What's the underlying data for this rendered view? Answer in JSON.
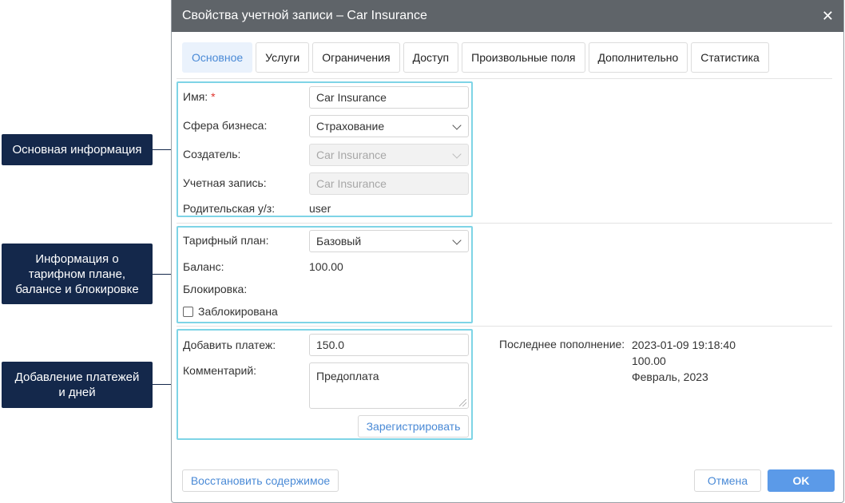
{
  "callouts": {
    "basic": "Основная информация",
    "plan_line1": "Информация о",
    "plan_line2": "тарифном плане,",
    "plan_line3": "балансе и блокировке",
    "payments_line1": "Добавление платежей",
    "payments_line2": "и дней"
  },
  "dialog": {
    "title": "Свойства учетной записи – Car Insurance",
    "close_glyph": "✕"
  },
  "tabs": [
    {
      "label": "Основное",
      "active": true
    },
    {
      "label": "Услуги"
    },
    {
      "label": "Ограничения"
    },
    {
      "label": "Доступ"
    },
    {
      "label": "Произвольные поля"
    },
    {
      "label": "Дополнительно"
    },
    {
      "label": "Статистика"
    }
  ],
  "basic": {
    "name_label": "Имя:",
    "required_mark": "*",
    "name_value": "Car Insurance",
    "business_label": "Сфера бизнеса:",
    "business_value": "Страхование",
    "creator_label": "Создатель:",
    "creator_value": "Car Insurance",
    "account_label": "Учетная запись:",
    "account_value": "Car Insurance",
    "parent_label": "Родительская у/з:",
    "parent_value": "user"
  },
  "plan": {
    "plan_label": "Тарифный план:",
    "plan_value": "Базовый",
    "balance_label": "Баланс:",
    "balance_value": "100.00",
    "block_label": "Блокировка:",
    "blocked_checkbox_label": "Заблокирована",
    "blocked": false
  },
  "payments": {
    "add_payment_label": "Добавить платеж:",
    "add_payment_value": "150.0",
    "comment_label": "Комментарий:",
    "comment_value": "Предоплата",
    "register_button": "Зарегистрировать",
    "last_topup_label": "Последнее пополнение:",
    "last_topup_date": "2023-01-09 19:18:40",
    "last_topup_amount": "100.00",
    "last_topup_period": "Февраль, 2023"
  },
  "footer": {
    "restore_button": "Восстановить содержимое",
    "cancel_button": "Отмена",
    "ok_button": "OK"
  },
  "colors": {
    "titlebar": "#5f6469",
    "accent": "#4a8ad6",
    "primary_button": "#5b9ae8",
    "section_border": "#7ed4e6",
    "callout_bg": "#14284b"
  },
  "icons": {
    "close": "close-icon",
    "dropdown": "chevron-down-icon",
    "checkbox": "checkbox-icon",
    "resize": "resize-handle-icon"
  }
}
